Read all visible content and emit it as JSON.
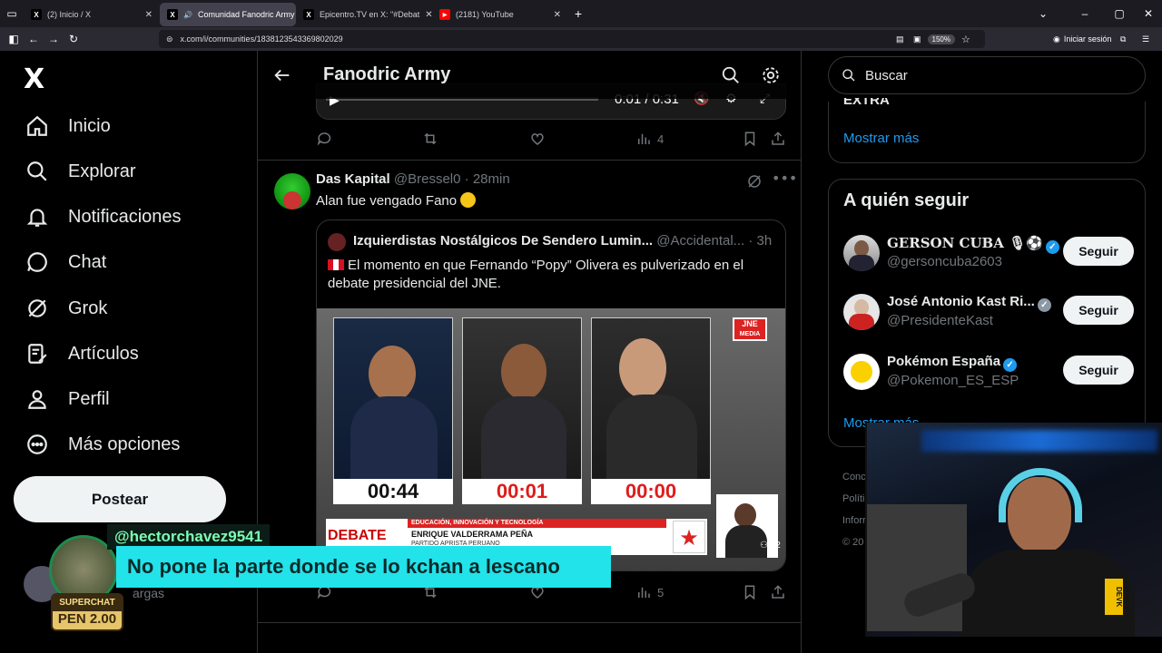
{
  "browser": {
    "tabs": [
      {
        "label": "(2) Inicio / X",
        "active": false
      },
      {
        "label": "Comunidad Fanodric Army",
        "active": true
      },
      {
        "label": "Epicentro.TV en X: \"#Debat",
        "active": false
      },
      {
        "label": "(2181) YouTube",
        "active": false
      }
    ],
    "url": "x.com/i/communities/1838123543369802029",
    "zoom": "150%",
    "signin": "Iniciar sesión"
  },
  "sidebar": {
    "logo": "X",
    "items": [
      {
        "label": "Inicio",
        "icon": "home-icon"
      },
      {
        "label": "Explorar",
        "icon": "search-icon"
      },
      {
        "label": "Notificaciones",
        "icon": "bell-icon"
      },
      {
        "label": "Chat",
        "icon": "chat-icon"
      },
      {
        "label": "Grok",
        "icon": "grok-icon"
      },
      {
        "label": "Artículos",
        "icon": "article-icon"
      },
      {
        "label": "Perfil",
        "icon": "person-icon"
      },
      {
        "label": "Más opciones",
        "icon": "more-icon"
      }
    ],
    "post_button": "Postear",
    "account_partial": "argas"
  },
  "main": {
    "title": "Fanodric Army",
    "video_time": "0:01 / 0:31",
    "post1_views": "4",
    "post2": {
      "author": "Das Kapital",
      "handle": "@Bressel0",
      "time": "28min",
      "text": "Alan fue vengado Fano",
      "views": "5",
      "quote": {
        "author": "Izquierdistas Nostálgicos De Sendero Lumin...",
        "handle": "@Accidental...",
        "time": "3h",
        "text": "El momento en que Fernando “Popy” Olivera es pulverizado en el debate presidencial del JNE.",
        "timers": [
          "00:44",
          "00:01",
          "00:00"
        ],
        "jne_label": "JNE",
        "media_label": "MEDIA",
        "debate_label": "DEBATE",
        "topic": "EDUCACIÓN, INNOVACIÓN Y TECNOLOGÍA",
        "speaker": "ENRIQUE VALDERRAMA PEÑA",
        "party": "PARTIDO APRISTA PERUANO",
        "watch_count": "12"
      }
    }
  },
  "right": {
    "search_placeholder": "Buscar",
    "trend_partial": "EXTRA",
    "show_more": "Mostrar más",
    "who_to_follow": "A quién seguir",
    "suggestions": [
      {
        "name": "GERSON CUBA 🎙⚽",
        "handle": "@gersoncuba2603",
        "button": "Seguir"
      },
      {
        "name": "José Antonio Kast Ri...",
        "handle": "@PresidenteKast",
        "button": "Seguir"
      },
      {
        "name": "Pokémon España",
        "handle": "@Pokemon_ES_ESP",
        "button": "Seguir"
      }
    ],
    "show_more2": "Mostrar más",
    "footer_partial": [
      "Conc",
      "Políti",
      "Inforr",
      "© 20"
    ]
  },
  "overlay": {
    "superchat_user": "@hectorchavez9541",
    "superchat_message": "No pone la parte donde se lo kchan a lescano",
    "superchat_label": "SUPERCHAT",
    "superchat_amount": "PEN 2.00",
    "webcam_brand": "DEVK"
  }
}
